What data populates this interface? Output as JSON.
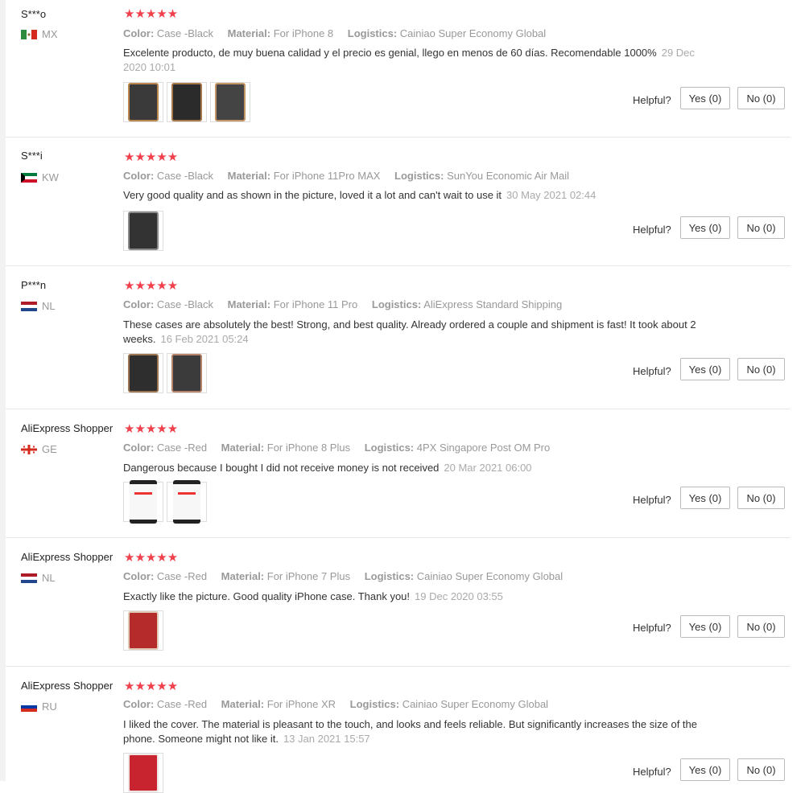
{
  "labels": {
    "color": "Color:",
    "material": "Material:",
    "logistics": "Logistics:",
    "helpful": "Helpful?"
  },
  "colors": {
    "star": "#f1404b",
    "meta": "#999999",
    "text": "#333333"
  },
  "reviews": [
    {
      "name": "S***o",
      "country": "MX",
      "flag": "mexico-flag-icon",
      "rating": 4.5,
      "stars": "★★★★★",
      "color": "Case -Black",
      "material": "For iPhone 8",
      "logistics": "Cainiao Super Economy Global",
      "text": "Excelente producto, de muy buena calidad y el precio es genial, llego en menos de 60 días. Recomendable 1000%",
      "date": "29 Dec 2020 10:01",
      "yes": "Yes (0)",
      "no": "No (0)"
    },
    {
      "name": "S***i",
      "country": "KW",
      "flag": "kuwait-flag-icon",
      "rating": 5,
      "stars": "★★★★★",
      "color": "Case -Black",
      "material": "For iPhone 11Pro MAX",
      "logistics": "SunYou Economic Air Mail",
      "text": "Very good quality and as shown in the picture, loved it a lot and can't wait to use it",
      "date": "30 May 2021 02:44",
      "yes": "Yes (0)",
      "no": "No (0)"
    },
    {
      "name": "P***n",
      "country": "NL",
      "flag": "netherlands-flag-icon",
      "rating": 4.5,
      "stars": "★★★★★",
      "color": "Case -Black",
      "material": "For iPhone 11 Pro",
      "logistics": "AliExpress Standard Shipping",
      "text": "These cases are absolutely the best! Strong, and best quality. Already ordered a couple and shipment is fast! It took about 2 weeks.",
      "date": "16 Feb 2021 05:24",
      "yes": "Yes (0)",
      "no": "No (0)"
    },
    {
      "name": "AliExpress Shopper",
      "country": "GE",
      "flag": "georgia-flag-icon",
      "rating": 5,
      "stars": "★★★★★",
      "color": "Case -Red",
      "material": "For iPhone 8 Plus",
      "logistics": "4PX Singapore Post OM Pro",
      "text": "Dangerous because I bought I did not receive money is not received",
      "date": "20 Mar 2021 06:00",
      "yes": "Yes (0)",
      "no": "No (0)"
    },
    {
      "name": "AliExpress Shopper",
      "country": "NL",
      "flag": "netherlands-flag-icon",
      "rating": 4.5,
      "stars": "★★★★★",
      "color": "Case -Red",
      "material": "For iPhone 7 Plus",
      "logistics": "Cainiao Super Economy Global",
      "text": "Exactly like the picture. Good quality iPhone case. Thank you!",
      "date": "19 Dec 2020 03:55",
      "yes": "Yes (0)",
      "no": "No (0)"
    },
    {
      "name": "AliExpress Shopper",
      "country": "RU",
      "flag": "russia-flag-icon",
      "rating": 5,
      "stars": "★★★★★",
      "color": "Case -Red",
      "material": "For iPhone XR",
      "logistics": "Cainiao Super Economy Global",
      "text": "I liked the cover. The material is pleasant to the touch, and looks and feels reliable. But significantly increases the size of the phone. Someone might not like it.",
      "date": "13 Jan 2021 15:57",
      "yes": "Yes (0)",
      "no": "No (0)"
    }
  ]
}
